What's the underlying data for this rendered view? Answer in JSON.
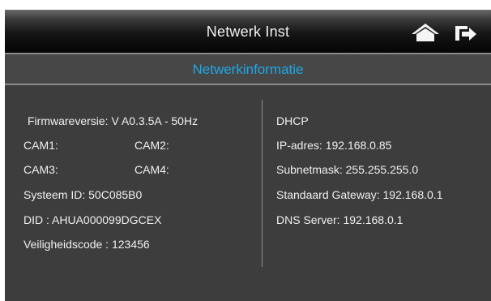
{
  "header": {
    "title": "Netwerk Inst",
    "home_icon": "home-icon",
    "exit_icon": "exit-icon"
  },
  "section": {
    "title": "Netwerkinformatie"
  },
  "device_info": {
    "firmware": "Firmwareversie: V A0.3.5A - 50Hz",
    "cam1": "CAM1:",
    "cam2": "CAM2:",
    "cam3": "CAM3:",
    "cam4": "CAM4:",
    "system_id": "Systeem ID: 50C085B0",
    "did": "DID : AHUA000099DGCEX",
    "security_code": "Veiligheidscode : 123456"
  },
  "network_info": {
    "dhcp": "DHCP",
    "ip": "IP-adres: 192.168.0.85",
    "subnet": "Subnetmask: 255.255.255.0",
    "gateway": "Standaard Gateway: 192.168.0.1",
    "dns": "DNS Server: 192.168.0.1"
  },
  "colors": {
    "accent": "#1ea8e8",
    "background": "#3d3d3d",
    "text": "#f0f0f0"
  }
}
